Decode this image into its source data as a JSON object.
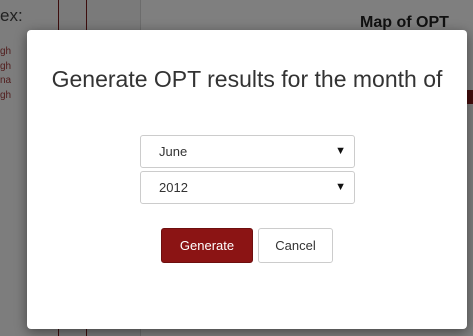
{
  "background": {
    "sidebar_heading": "ex:",
    "sidebar_items": [
      "gh",
      "gh",
      "na",
      "gh"
    ],
    "map_title": "Map of OPT"
  },
  "dialog": {
    "title": "Generate OPT results for the month of",
    "month_select": {
      "value": "June",
      "arrow": "▼"
    },
    "year_select": {
      "value": "2012",
      "arrow": "▼"
    },
    "generate_label": "Generate",
    "cancel_label": "Cancel"
  },
  "colors": {
    "primary_button": "#8b1414",
    "overlay": "rgba(0,0,0,0.5)",
    "modal_background": "#ffffff"
  }
}
